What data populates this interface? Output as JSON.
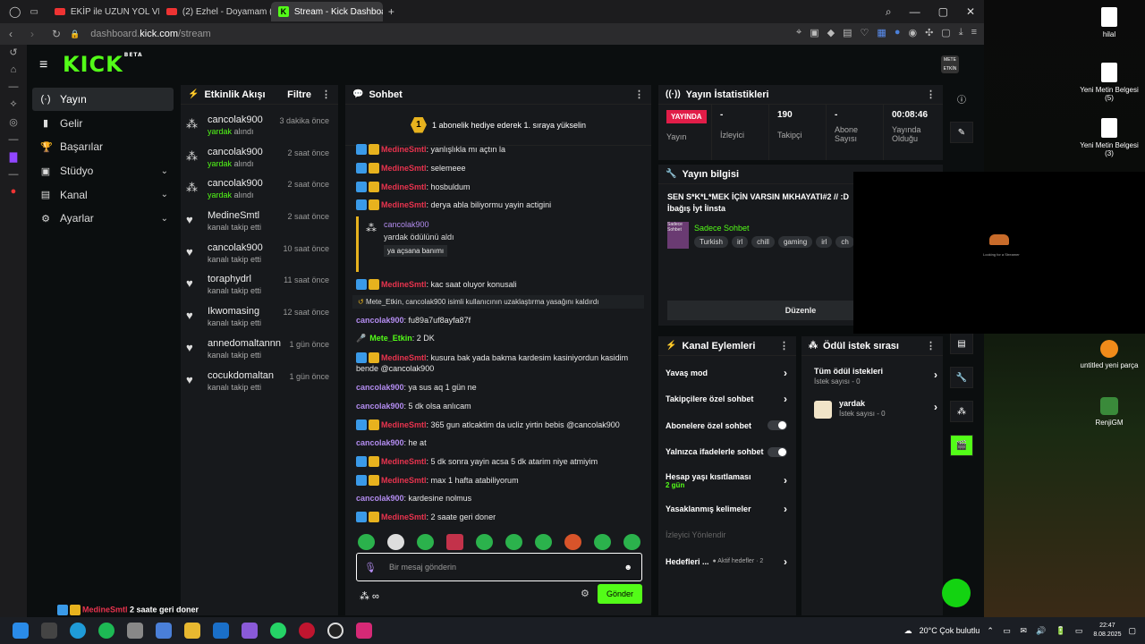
{
  "browser": {
    "tabs": [
      {
        "label": "EKİP ile UZUN YOL VLOG"
      },
      {
        "label": "(2) Ezhel - Doyamam (Offi"
      },
      {
        "label": "Stream - Kick Dashboard"
      }
    ],
    "url_prefix": "dashboard.",
    "url_domain": "kick.com",
    "url_path": "/stream",
    "window_controls": [
      "search-icon",
      "minimize-icon",
      "maximize-icon",
      "close-icon"
    ]
  },
  "header": {
    "logo": "KICK",
    "logo_sup": "BETA",
    "avatar_text": "METE ETKİN"
  },
  "sidenav": {
    "items": [
      {
        "label": "Yayın",
        "icon": "(·)"
      },
      {
        "label": "Gelir",
        "icon": "▮"
      },
      {
        "label": "Başarılar",
        "icon": "🏆"
      },
      {
        "label": "Stüdyo",
        "icon": "▣"
      },
      {
        "label": "Kanal",
        "icon": "▤"
      },
      {
        "label": "Ayarlar",
        "icon": "⚙"
      }
    ]
  },
  "activity": {
    "title": "Etkinlik Akışı",
    "filter": "Filtre",
    "items": [
      {
        "name": "cancolak900",
        "sub_hl": "yardak",
        "sub": " alındı",
        "time": "3 dakika önce"
      },
      {
        "name": "cancolak900",
        "sub_hl": "yardak",
        "sub": " alındı",
        "time": "2 saat önce"
      },
      {
        "name": "cancolak900",
        "sub_hl": "yardak",
        "sub": " alındı",
        "time": "2 saat önce"
      },
      {
        "name": "MedineSmtl",
        "sub_hl": "",
        "sub": "kanalı takip etti",
        "time": "2 saat önce"
      },
      {
        "name": "cancolak900",
        "sub_hl": "",
        "sub": "kanalı takip etti",
        "time": "10 saat önce"
      },
      {
        "name": "toraphydrl",
        "sub_hl": "",
        "sub": "kanalı takip etti",
        "time": "11 saat önce"
      },
      {
        "name": "Ikwomasing",
        "sub_hl": "",
        "sub": "kanalı takip etti",
        "time": "12 saat önce"
      },
      {
        "name": "annedomaltannn",
        "sub_hl": "",
        "sub": "kanalı takip etti",
        "time": "1 gün önce"
      },
      {
        "name": "cocukdomaltan",
        "sub_hl": "",
        "sub": "kanalı takip etti",
        "time": "1 gün önce"
      }
    ]
  },
  "chat": {
    "title": "Sohbet",
    "pinned_number": "1",
    "pinned": "1 abonelik hediye ederek 1. sıraya yükselin",
    "messages_top": [
      {
        "user": "MedineSmtl",
        "text": ": yanlışlıkla mı açtın la"
      },
      {
        "user": "MedineSmtl",
        "text": ": selemeee"
      },
      {
        "user": "MedineSmtl",
        "text": ": hosbuldum"
      },
      {
        "user": "MedineSmtl",
        "text": ": derya abla biliyormu yayin actigini"
      }
    ],
    "reward": {
      "user": "cancolak900",
      "text": "yardak ödülünü aldı",
      "tag": "ya açsana banımı"
    },
    "msg_after_reward": {
      "user": "MedineSmtl",
      "text": ": kac saat oluyor konusali"
    },
    "system": "Mete_Etkin, cancolak900 isimli kullanıcının uzaklaştırma yasağını kaldırdı",
    "messages_bottom": [
      {
        "type": "pur",
        "user": "cancolak900",
        "text": ": fu89a7uf8ayfa87f"
      },
      {
        "type": "grn",
        "user": "Mete_Etkin",
        "text": ": 2 DK"
      },
      {
        "type": "red",
        "user": "MedineSmtl",
        "text": ": kusura bak yada bakma kardesim kasiniyordun kasidim bende @cancolak900"
      },
      {
        "type": "pur",
        "user": "cancolak900",
        "text": ": ya sus aq 1 gün ne"
      },
      {
        "type": "pur",
        "user": "cancolak900",
        "text": ": 5 dk olsa anlıcam"
      },
      {
        "type": "red",
        "user": "MedineSmtl",
        "text": ": 365 gun atlcaktim da ucliz yirtin bebis @cancolak900"
      },
      {
        "type": "pur",
        "user": "cancolak900",
        "text": ": he at"
      },
      {
        "type": "red",
        "user": "MedineSmtl",
        "text": ": 5 dk sonra yayin acsa 5 dk atarim niye atmiyim"
      },
      {
        "type": "red",
        "user": "MedineSmtl",
        "text": ": max 1 hafta atabiliyorum"
      },
      {
        "type": "pur",
        "user": "cancolak900",
        "text": ": kardesine nolmus"
      },
      {
        "type": "red",
        "user": "MedineSmtl",
        "text": ": 2 saate geri doner"
      }
    ],
    "input_placeholder": "Bir mesaj gönderin",
    "send": "Gönder"
  },
  "stats": {
    "title": "Yayın İstatistikleri",
    "live": "YAYINDA",
    "live_label": "Yayın",
    "items": [
      {
        "value": "-",
        "label": "İzleyici"
      },
      {
        "value": "190",
        "label": "Takipçi"
      },
      {
        "value": "-",
        "label": "Abone Sayısı"
      },
      {
        "value": "00:08:46",
        "label": "Yayında Olduğu"
      }
    ]
  },
  "stream_info": {
    "title_label": "Yayın bilgisi",
    "stream_title": "SEN S*K*L*MEK İÇİN VARSIN MKHAYATI#2 // :D İbağış İyt İinsta",
    "category": "Sadece Sohbet",
    "category_art": "Sadece Sohbet",
    "tags": [
      "Turkish",
      "irl",
      "chill",
      "gaming",
      "irl",
      "ch"
    ],
    "edit": "Düzenle"
  },
  "overlay": {
    "caption": "Looking for a Streamer"
  },
  "channel_actions": {
    "title": "Kanal Eylemleri",
    "rows": [
      {
        "label": "Yavaş mod",
        "kind": "arrow"
      },
      {
        "label": "Takipçilere özel sohbet",
        "kind": "arrow"
      },
      {
        "label": "Abonelere özel sohbet",
        "kind": "toggle"
      },
      {
        "label": "Yalnızca ifadelerle sohbet",
        "kind": "toggle"
      }
    ],
    "account_age": "Hesap yaşı kısıtlaması",
    "account_age_sub": "2 gün",
    "banned_words": "Yasaklanmış kelimeler",
    "viewer_redirect": "İzleyici Yönlendir",
    "goals": "Hedefleri ...",
    "goals_sub": "● Aktif hedefler · 2"
  },
  "reward_queue": {
    "title": "Ödül istek sırası",
    "rows": [
      {
        "name": "Tüm ödül istekleri",
        "sub": "İstek sayısı - 0"
      },
      {
        "name": "yardak",
        "sub": "İstek sayısı - 0"
      }
    ]
  },
  "bottom_chat": {
    "user": "MedineSmtl",
    "text": " 2 saate geri doner"
  },
  "desktop": {
    "icons": [
      {
        "label": "hilal"
      },
      {
        "label": "Yeni Metin Belgesi (5)"
      },
      {
        "label": "Yeni Metin Belgesi (3)"
      },
      {
        "label": "untitled yeni parça"
      },
      {
        "label": "RenjiGM"
      }
    ]
  },
  "taskbar": {
    "weather": "20°C  Çok bulutlu",
    "time": "22:47",
    "date": "8.08.2025"
  },
  "colors": {
    "kick_green": "#53fc18",
    "live_red": "#e11d48",
    "sub_gold": "#e7b21e",
    "user_purple": "#b38cf0",
    "user_red": "#e8334e"
  }
}
